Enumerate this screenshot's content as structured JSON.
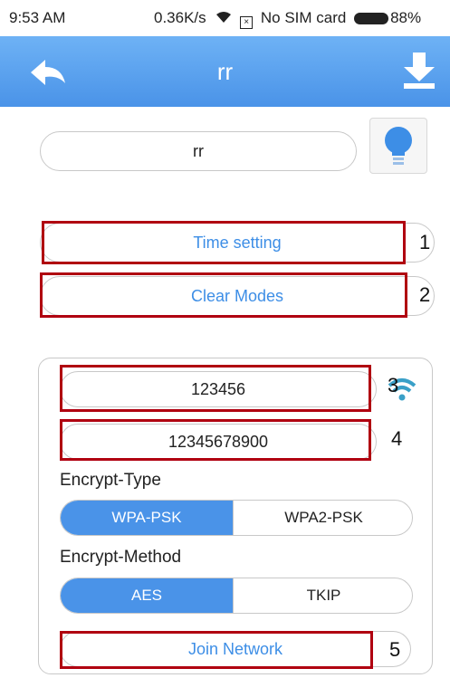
{
  "status_bar": {
    "time": "9:53 AM",
    "speed": "0.36K/s",
    "sim": "No SIM card",
    "battery": "88%"
  },
  "header": {
    "title": "rr",
    "back_icon": "back-arrow-icon",
    "download_icon": "download-icon"
  },
  "device": {
    "name": "rr",
    "bulb_icon": "lightbulb-icon"
  },
  "actions": {
    "time_setting": "Time setting",
    "clear_modes": "Clear Modes"
  },
  "network": {
    "ssid": "123456",
    "password": "12345678900",
    "wifi_icon": "wifi-icon",
    "encrypt_type_label": "Encrypt-Type",
    "encrypt_type_options": [
      "WPA-PSK",
      "WPA2-PSK"
    ],
    "encrypt_type_selected": "WPA-PSK",
    "encrypt_method_label": "Encrypt-Method",
    "encrypt_method_options": [
      "AES",
      "TKIP"
    ],
    "encrypt_method_selected": "AES",
    "join_label": "Join Network"
  },
  "annotations": [
    "1",
    "2",
    "3",
    "4",
    "5"
  ],
  "colors": {
    "accent": "#4a93e8",
    "link_text": "#3d8ee6",
    "highlight_box": "#b00010"
  }
}
